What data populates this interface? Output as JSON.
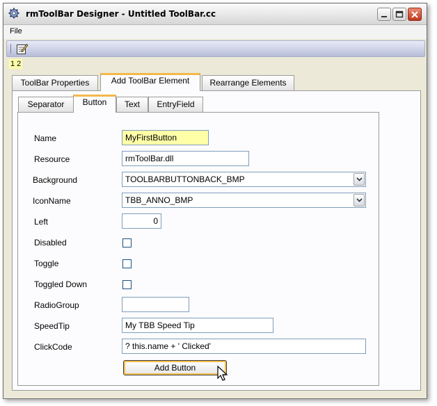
{
  "window": {
    "title": "rmToolBar Designer -  Untitled ToolBar.cc"
  },
  "titlebar_buttons": {
    "minimize_icon": "minimize-icon",
    "maximize_icon": "maximize-icon",
    "close_icon": "close-icon"
  },
  "menu": {
    "file": "File"
  },
  "toolbar": {
    "edit_icon": "pencil-notepad-icon",
    "numbers": "1 2"
  },
  "tabs": [
    {
      "label": "ToolBar Properties",
      "active": false
    },
    {
      "label": "Add ToolBar Element",
      "active": true
    },
    {
      "label": "Rearrange Elements",
      "active": false
    }
  ],
  "subtabs": [
    {
      "label": "Separator",
      "active": false
    },
    {
      "label": "Button",
      "active": true
    },
    {
      "label": "Text",
      "active": false
    },
    {
      "label": "EntryField",
      "active": false
    }
  ],
  "form": {
    "name": {
      "label": "Name",
      "value": "MyFirstButton"
    },
    "resource": {
      "label": "Resource",
      "value": "rmToolBar.dll"
    },
    "background": {
      "label": "Background",
      "value": "TOOLBARBUTTONBACK_BMP"
    },
    "iconname": {
      "label": "IconName",
      "value": "TBB_ANNO_BMP"
    },
    "left": {
      "label": "Left",
      "value": "0"
    },
    "disabled": {
      "label": "Disabled",
      "checked": false
    },
    "toggle": {
      "label": "Toggle",
      "checked": false
    },
    "toggled_down": {
      "label": "Toggled Down",
      "checked": false
    },
    "radiogroup": {
      "label": "RadioGroup",
      "value": ""
    },
    "speedtip": {
      "label": "SpeedTip",
      "value": "My TBB Speed Tip"
    },
    "clickcode": {
      "label": "ClickCode",
      "value": "? this.name + ' Clicked'"
    },
    "add_button": "Add Button"
  }
}
